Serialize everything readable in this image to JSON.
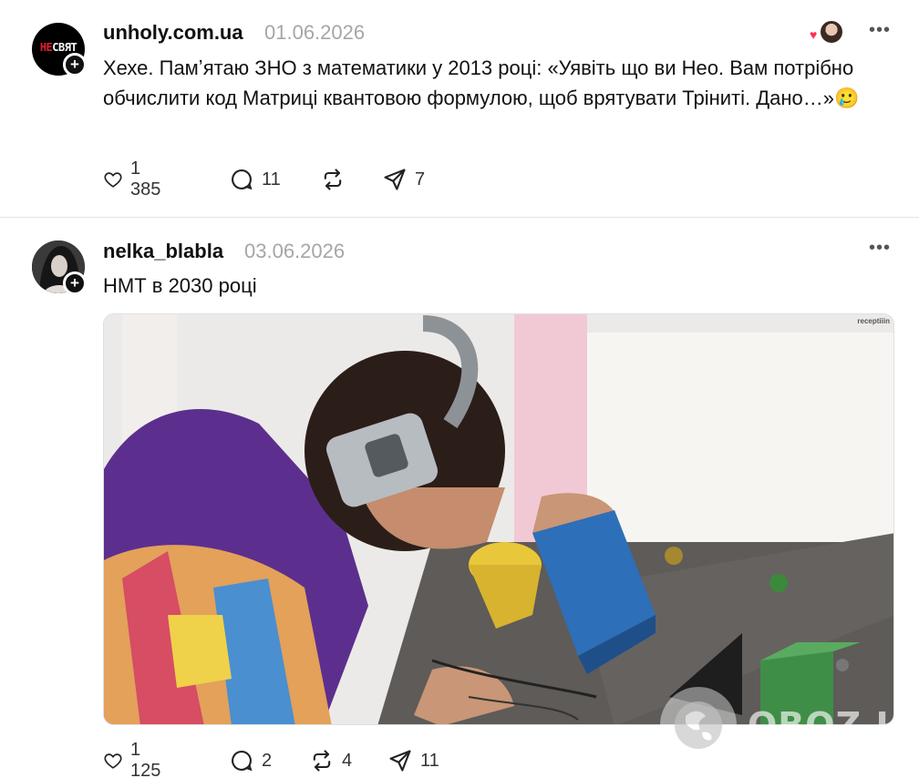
{
  "posts": [
    {
      "avatar_text_1": "НЕ",
      "avatar_text_2": "СВЯТ",
      "username": "unholy.com.ua",
      "date": "01.06.2026",
      "text": "Хехе. Памʼятаю ЗНО з математики у 2013 році: «Уявіть що ви Нео. Вам потрібно обчислити код Матриці квантовою формулою, щоб врятувати Тріниті. Дано…»🥲",
      "likes": "1 385",
      "replies": "11",
      "reposts": "",
      "shares": "7"
    },
    {
      "username": "nelka_blabla",
      "date": "03.06.2026",
      "text": "НМТ в 2030 році",
      "media_watermark": "receptiiin",
      "likes": "1 125",
      "replies": "2",
      "reposts": "4",
      "shares": "11"
    }
  ],
  "overlay": {
    "watermark": "OBOZ.UA"
  },
  "icons": {
    "like": "heart-icon",
    "reply": "comment-icon",
    "repost": "repost-icon",
    "share": "share-icon",
    "more": "more-icon",
    "follow": "plus-icon"
  },
  "colors": {
    "text": "#111111",
    "muted": "#a6a6a6",
    "heart": "#ff2e55"
  }
}
